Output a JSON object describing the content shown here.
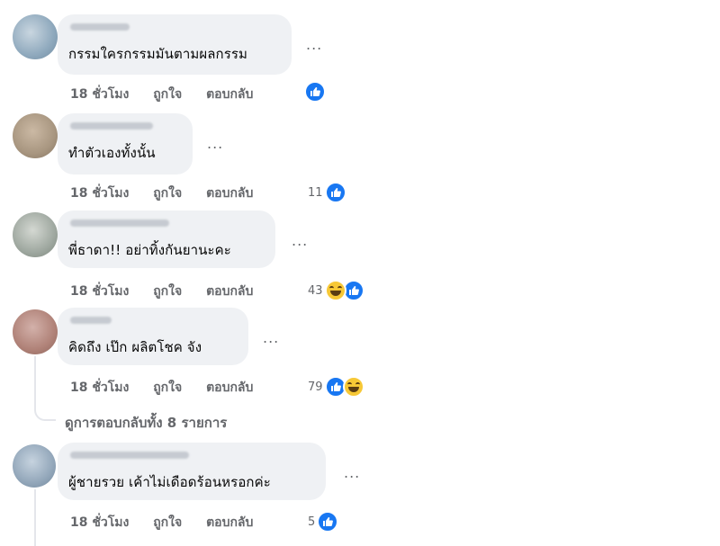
{
  "comments": [
    {
      "text": "กรรมใครกรรมมันตามผลกรรม",
      "time": "18 ชั่วโมง",
      "like": "ถูกใจ",
      "reply": "ตอบกลับ",
      "count": "",
      "more": "...",
      "reactions": [
        "like"
      ],
      "avatar_color": "#8fa9bd"
    },
    {
      "text": "ทำตัวเองทั้งนั้น",
      "time": "18 ชั่วโมง",
      "like": "ถูกใจ",
      "reply": "ตอบกลับ",
      "count": "11",
      "more": "...",
      "reactions": [
        "like"
      ],
      "avatar_color": "#a89680"
    },
    {
      "text": "พี่ธาดา!! อย่าทิ้งกันยานะคะ",
      "time": "18 ชั่วโมง",
      "like": "ถูกใจ",
      "reply": "ตอบกลับ",
      "count": "43",
      "more": "...",
      "reactions": [
        "haha",
        "like"
      ],
      "avatar_color": "#9fa8a0"
    },
    {
      "text": "คิดถึง เป๊ก ผลิตโชค จัง",
      "time": "18 ชั่วโมง",
      "like": "ถูกใจ",
      "reply": "ตอบกลับ",
      "count": "79",
      "more": "...",
      "reactions": [
        "like",
        "haha"
      ],
      "avatar_color": "#b08278"
    },
    {
      "text": "ผู้ชายรวย เค้าไม่เดือดร้อนหรอกค่ะ",
      "time": "18 ชั่วโมง",
      "like": "ถูกใจ",
      "reply": "ตอบกลับ",
      "count": "5",
      "more": "...",
      "reactions": [
        "like"
      ],
      "avatar_color": "#93a7ba"
    }
  ],
  "view_replies": "ดูการตอบกลับทั้ง 8 รายการ",
  "colors": {
    "bubble": "#eff1f4",
    "secondary_text": "#65676b",
    "like_blue": "#1877f2",
    "haha_yellow": "#f7c836"
  }
}
